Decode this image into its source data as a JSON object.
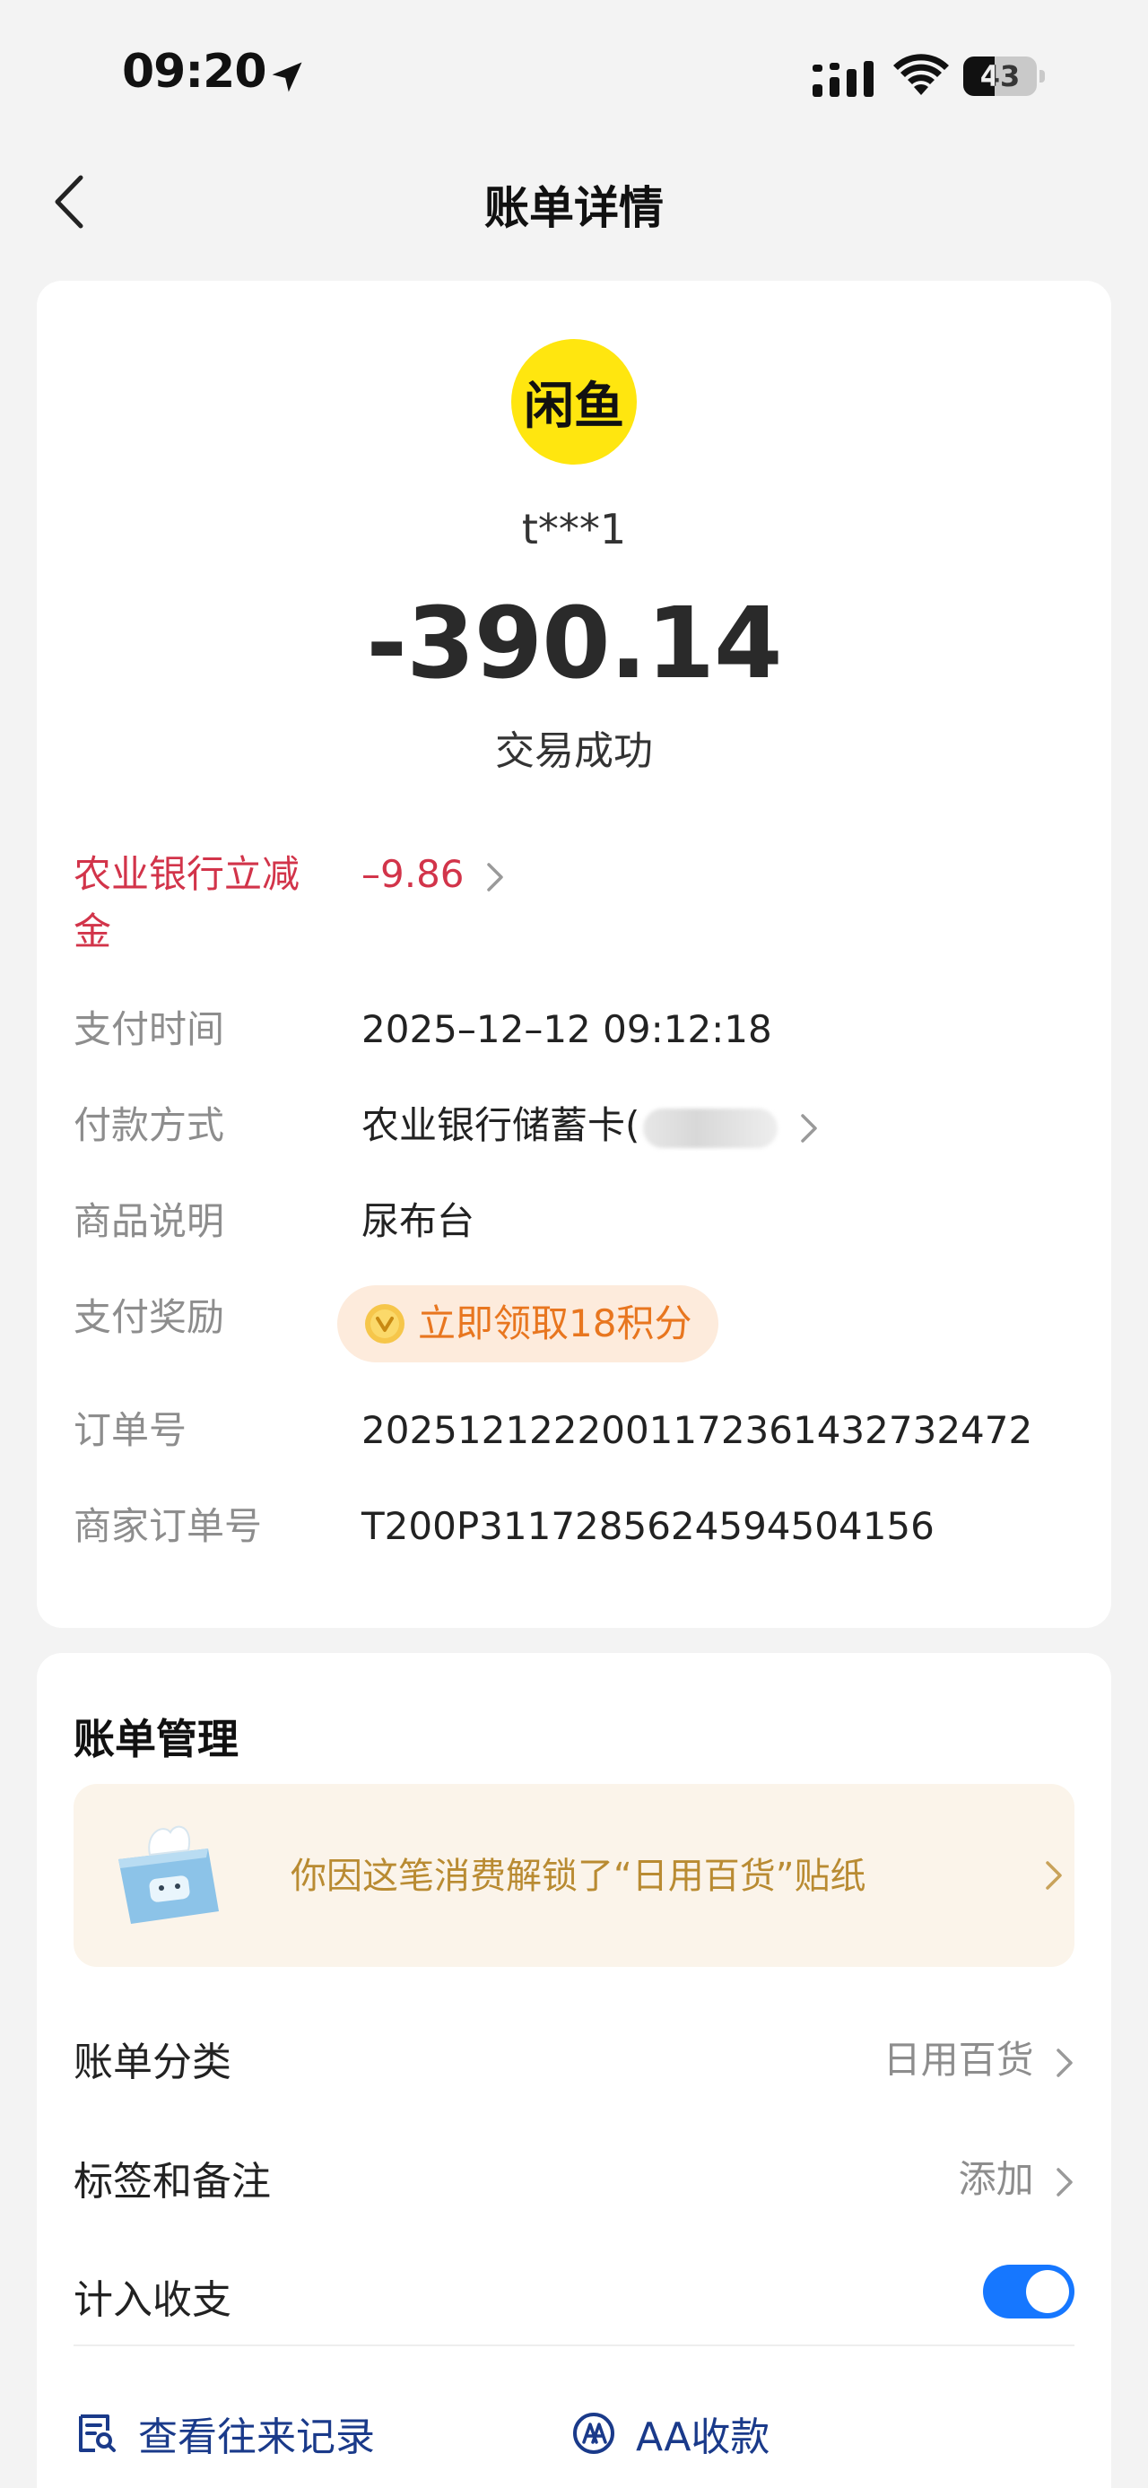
{
  "status_bar": {
    "time": "09:20",
    "battery_level": "43",
    "battery_fraction": 0.43,
    "icons": [
      "location-arrow-icon",
      "cellular-signal-icon",
      "wifi-icon",
      "battery-icon"
    ]
  },
  "nav": {
    "title": "账单详情",
    "back_icon": "chevron-left-icon"
  },
  "transaction": {
    "merchant_logo_text": "闲鱼",
    "merchant_logo_color": "#ffe60f",
    "merchant_name": "t***1",
    "amount": "-390.14",
    "status": "交易成功",
    "discount": {
      "label": "农业银行立减金",
      "value": "–9.86"
    },
    "details": {
      "pay_time": {
        "label": "支付时间",
        "value": "2025–12–12 09:12:18"
      },
      "pay_method": {
        "label": "付款方式",
        "value": "农业银行储蓄卡("
      },
      "product": {
        "label": "商品说明",
        "value": "尿布台"
      },
      "reward": {
        "label": "支付奖励",
        "value": "立即领取18积分"
      },
      "order_no": {
        "label": "订单号",
        "value": "2025121222001172361432732472"
      },
      "merchant_order_no": {
        "label": "商家订单号",
        "value": "T200P3117285624594504156"
      }
    }
  },
  "bill_management": {
    "title": "账单管理",
    "sticker_banner": "你因这笔消费解锁了“日用百货”贴纸",
    "category": {
      "label": "账单分类",
      "value": "日用百货"
    },
    "tags": {
      "label": "标签和备注",
      "value": "添加"
    },
    "include_in_budget": {
      "label": "计入收支",
      "enabled": true
    },
    "actions": {
      "history": "查看往来记录",
      "aa": "AA收款"
    }
  },
  "colors": {
    "accent_blue": "#1677ff",
    "discount_red": "#d2344a",
    "reward_orange": "#e8761f",
    "sticker_gold": "#b98b32",
    "link_navy": "#1a3a8a"
  }
}
